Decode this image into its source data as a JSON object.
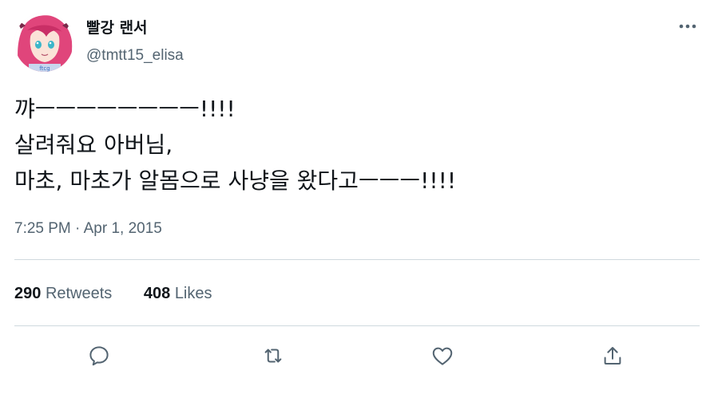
{
  "author": {
    "display_name": "빨강 랜서",
    "handle": "@tmtt15_elisa",
    "avatar_caption": "ftcg"
  },
  "tweet": {
    "lines": [
      "꺄ㅡㅡㅡㅡㅡㅡㅡㅡ!!!!",
      "살려줘요 아버님,",
      "마초, 마초가 알몸으로 사냥을 왔다고ㅡㅡㅡ!!!!"
    ],
    "time": "7:25 PM",
    "separator": "·",
    "date": "Apr 1, 2015"
  },
  "stats": {
    "retweets_count": "290",
    "retweets_label": "Retweets",
    "likes_count": "408",
    "likes_label": "Likes"
  },
  "actions": [
    "reply-icon",
    "retweet-icon",
    "like-icon",
    "share-icon"
  ],
  "colors": {
    "text": "#0f1419",
    "secondary": "#536471",
    "divider": "#cfd9de",
    "avatar_hair": "#e0457b"
  }
}
